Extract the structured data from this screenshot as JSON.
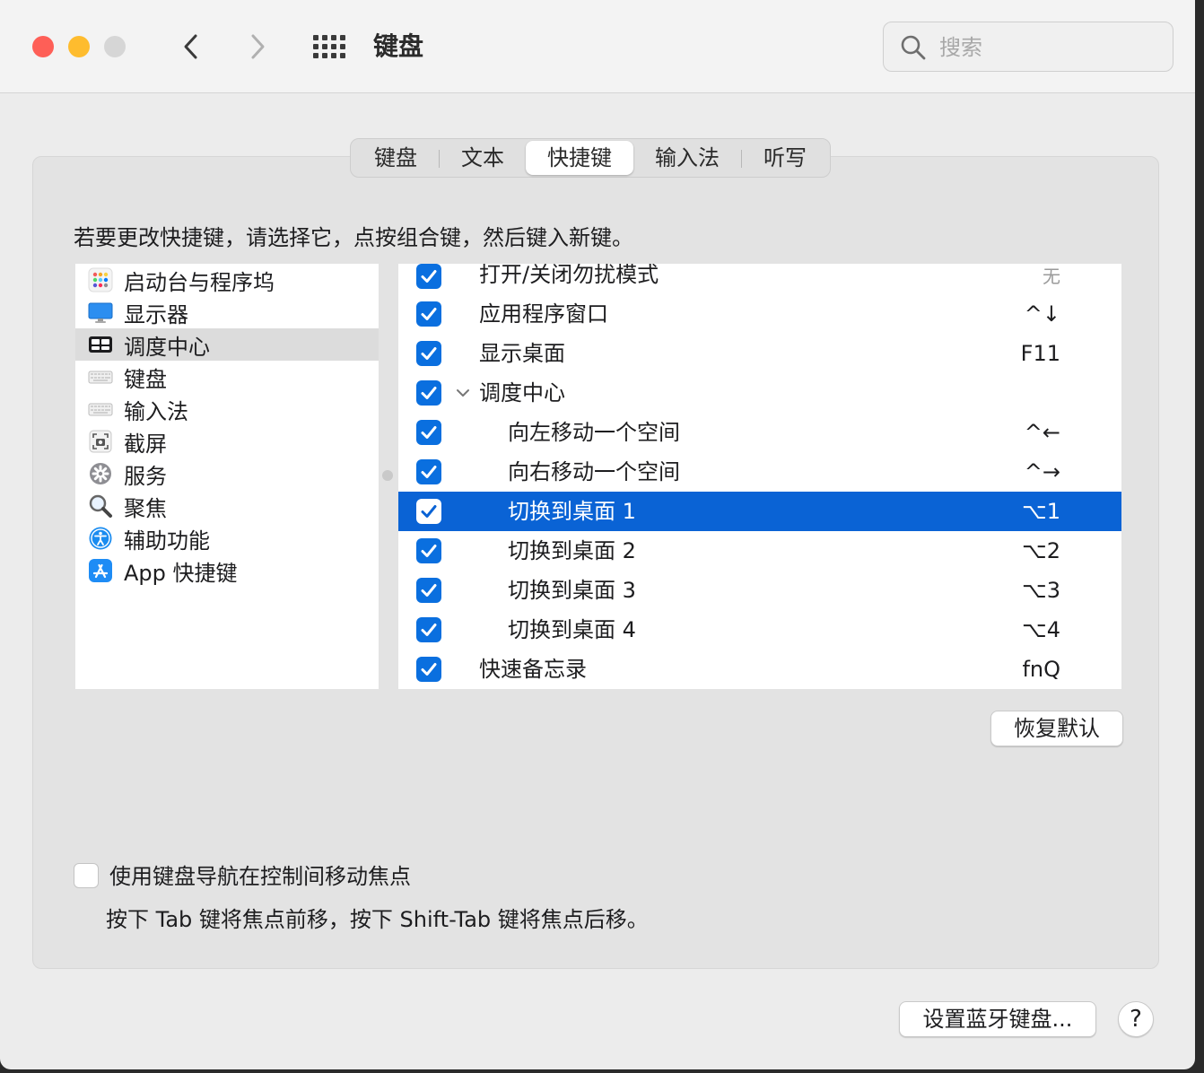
{
  "window": {
    "title": "键盘"
  },
  "search": {
    "placeholder": "搜索"
  },
  "tabs": [
    {
      "label": "键盘",
      "active": false
    },
    {
      "label": "文本",
      "active": false
    },
    {
      "label": "快捷键",
      "active": true
    },
    {
      "label": "输入法",
      "active": false
    },
    {
      "label": "听写",
      "active": false
    }
  ],
  "instructions": "若要更改快捷键，请选择它，点按组合键，然后键入新键。",
  "categories": [
    {
      "label": "启动台与程序坞",
      "icon": "launchpad-icon",
      "selected": false
    },
    {
      "label": "显示器",
      "icon": "display-icon",
      "selected": false
    },
    {
      "label": "调度中心",
      "icon": "mission-control-icon",
      "selected": true
    },
    {
      "label": "键盘",
      "icon": "keyboard-icon",
      "selected": false
    },
    {
      "label": "输入法",
      "icon": "input-method-icon",
      "selected": false
    },
    {
      "label": "截屏",
      "icon": "screenshot-icon",
      "selected": false
    },
    {
      "label": "服务",
      "icon": "gear-icon",
      "selected": false
    },
    {
      "label": "聚焦",
      "icon": "magnifier-icon",
      "selected": false
    },
    {
      "label": "辅助功能",
      "icon": "accessibility-icon",
      "selected": false
    },
    {
      "label": "App 快捷键",
      "icon": "app-store-icon",
      "selected": false
    }
  ],
  "shortcuts": [
    {
      "label": "打开/关闭勿扰模式",
      "shortcut": "无",
      "checked": true,
      "indent": 0,
      "dim": true
    },
    {
      "label": "应用程序窗口",
      "shortcut": "^↓",
      "checked": true,
      "indent": 0
    },
    {
      "label": "显示桌面",
      "shortcut": "F11",
      "checked": true,
      "indent": 0
    },
    {
      "label": "调度中心",
      "shortcut": "",
      "checked": true,
      "indent": 0,
      "expanded": true
    },
    {
      "label": "向左移动一个空间",
      "shortcut": "^←",
      "checked": true,
      "indent": 1
    },
    {
      "label": "向右移动一个空间",
      "shortcut": "^→",
      "checked": true,
      "indent": 1
    },
    {
      "label": "切换到桌面 1",
      "shortcut": "⌥1",
      "checked": true,
      "indent": 1,
      "selected": true
    },
    {
      "label": "切换到桌面 2",
      "shortcut": "⌥2",
      "checked": true,
      "indent": 1
    },
    {
      "label": "切换到桌面 3",
      "shortcut": "⌥3",
      "checked": true,
      "indent": 1
    },
    {
      "label": "切换到桌面 4",
      "shortcut": "⌥4",
      "checked": true,
      "indent": 1
    },
    {
      "label": "快速备忘录",
      "shortcut": "fnQ",
      "checked": true,
      "indent": 0
    }
  ],
  "buttons": {
    "restore_defaults": "恢复默认",
    "setup_bluetooth": "设置蓝牙键盘...",
    "help": "?"
  },
  "keyboard_navigation": {
    "label": "使用键盘导航在控制间移动焦点",
    "checked": false,
    "help_text": "按下 Tab 键将焦点前移，按下 Shift-Tab 键将焦点后移。"
  },
  "colors": {
    "accent": "#0a63d5",
    "close": "#fe5f57",
    "minimize": "#febc2e"
  }
}
